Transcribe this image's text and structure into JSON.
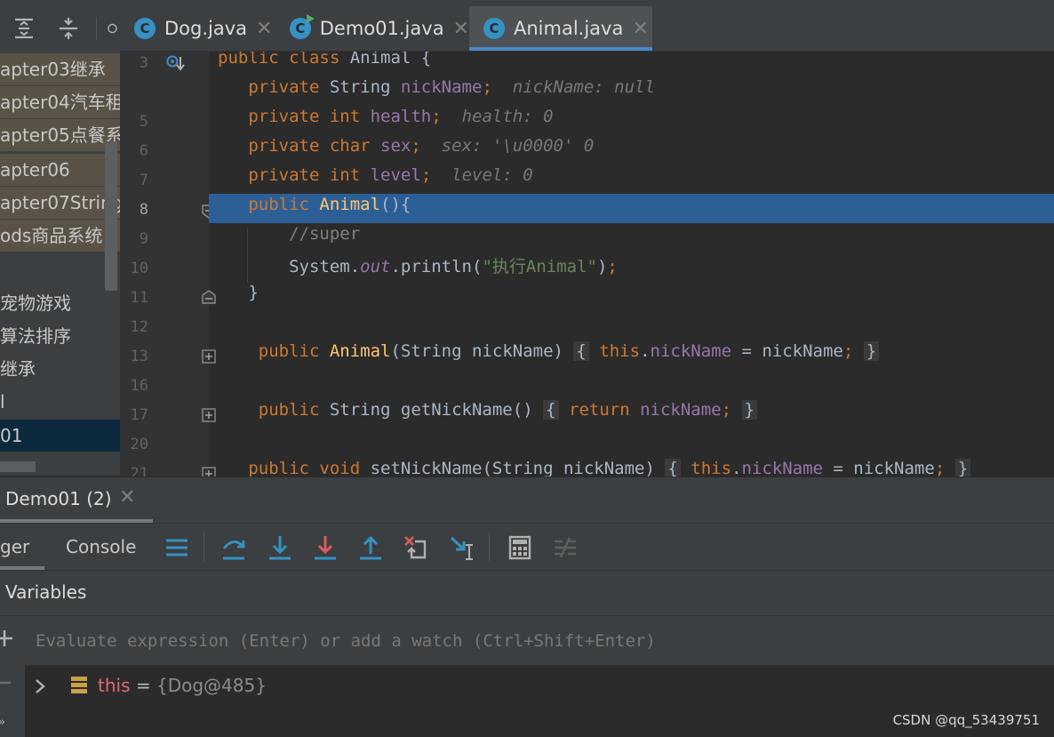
{
  "project_tree": {
    "items": [
      {
        "label": "apter03继承"
      },
      {
        "label": "apter04汽车租聘系统"
      },
      {
        "label": "apter05点餐系统"
      },
      {
        "label": "apter06"
      },
      {
        "label": "apter07String的"
      },
      {
        "label": "ods商品系统"
      },
      {
        "label": "宠物游戏"
      },
      {
        "label": "算法排序"
      },
      {
        "label": "继承"
      },
      {
        "label": "l"
      },
      {
        "label": "01"
      }
    ]
  },
  "editor_tabs": [
    {
      "label": "Dog.java",
      "icon": "class-icon"
    },
    {
      "label": "Demo01.java",
      "icon": "runnable-class-icon"
    },
    {
      "label": "Animal.java",
      "icon": "class-icon",
      "active": true
    }
  ],
  "editor": {
    "line_numbers": [
      "3",
      "5",
      "6",
      "7",
      "8",
      "9",
      "10",
      "11",
      "12",
      "13",
      "16",
      "17",
      "20",
      "21"
    ],
    "inline_values": {
      "nickName": "nickName: null",
      "health": "health: 0",
      "sex": "sex: '\\u0000' 0",
      "level": "level: 0"
    },
    "comment": "//super",
    "string_literal": "\"执行Animal\""
  },
  "debug": {
    "session_tab": "Demo01 (2)",
    "tabs": {
      "debugger": "ger",
      "console": "Console"
    },
    "variables_title": "Variables",
    "watch_placeholder": "Evaluate expression (Enter) or add a watch (Ctrl+Shift+Enter)",
    "variable": {
      "name": "this",
      "equals": "=",
      "value": "{Dog@485}"
    }
  },
  "watermark": "CSDN @qq_53439751",
  "colors": {
    "accent": "#4a88c7",
    "execution_line": "#2d5f97",
    "keyword": "#cc7832",
    "field": "#9876aa"
  }
}
